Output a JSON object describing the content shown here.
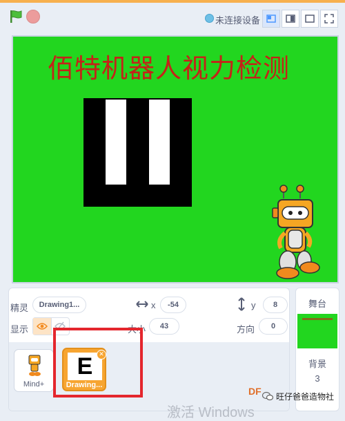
{
  "topbar": {
    "connection_status": "未连接设备",
    "view_buttons": [
      "small-stage-icon",
      "large-stage-icon",
      "fullscreen-icon"
    ]
  },
  "stage": {
    "title": "佰特机器人视力检测",
    "background_color": "#22d61f",
    "title_color": "#c42318"
  },
  "sprite_info": {
    "sprite_label": "精灵",
    "sprite_name": "Drawing1...",
    "x_label": "x",
    "x_value": "-54",
    "y_label": "y",
    "y_value": "8",
    "show_label": "显示",
    "size_label": "大小",
    "size_value": "43",
    "direction_label": "方向",
    "direction_value": "0"
  },
  "sprites": [
    {
      "name": "Mind+",
      "selected": false
    },
    {
      "name": "Drawing...",
      "selected": true
    }
  ],
  "stage_panel": {
    "label": "舞台",
    "backdrop_label": "背景",
    "backdrop_count": "3"
  },
  "overlay": {
    "watermark": "激活 Windows",
    "wechat_label": "旺仔爸爸造物社",
    "df": "DF"
  }
}
